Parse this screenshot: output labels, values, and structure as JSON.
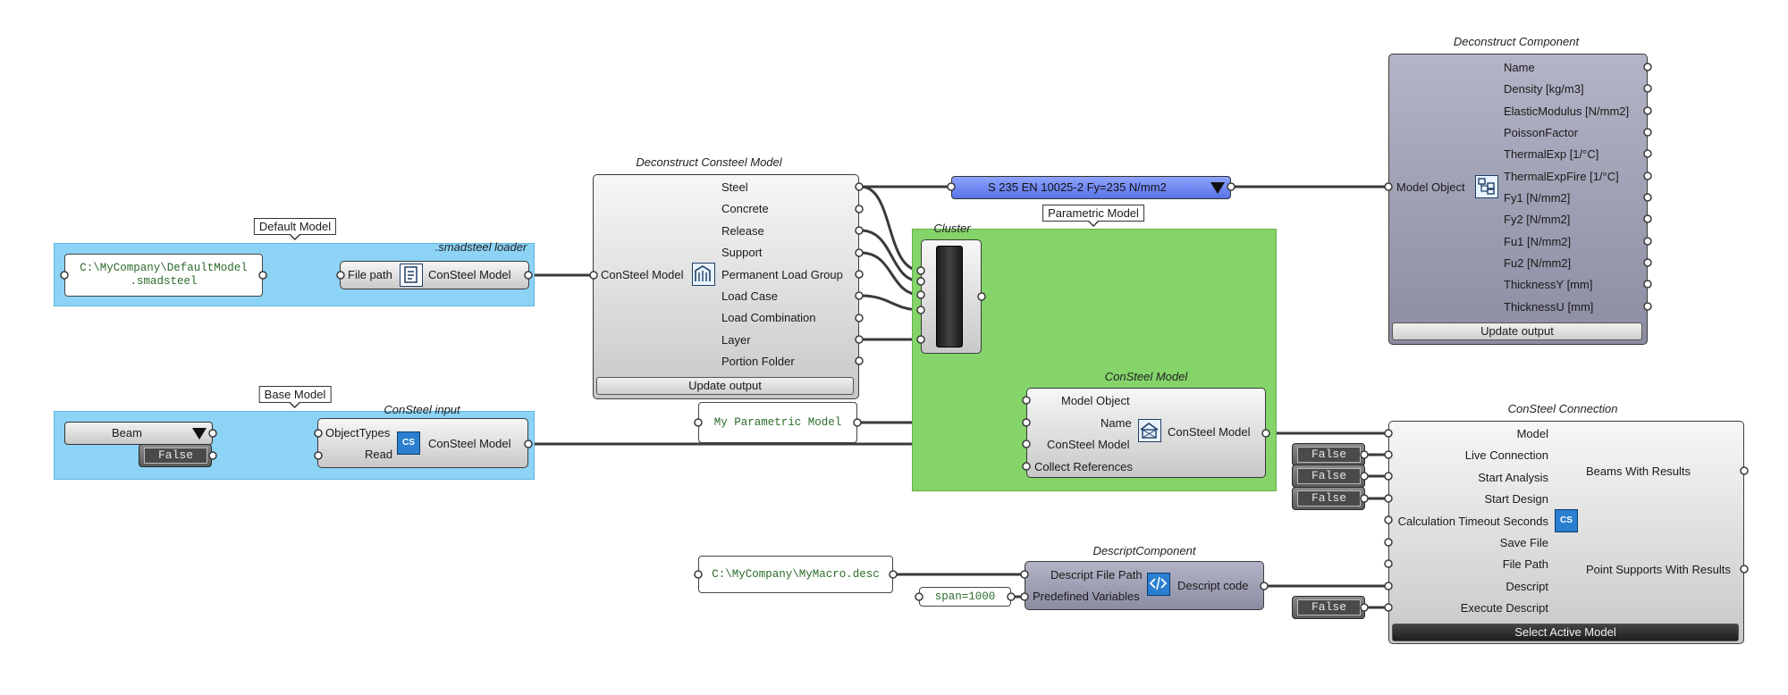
{
  "groups": {
    "default_model": {
      "tag": "Default Model",
      "title": ".smadsteel loader"
    },
    "base_model": {
      "tag": "Base Model",
      "title": "ConSteel input"
    },
    "parametric_model": {
      "tag": "Parametric Model",
      "title": "Cluster"
    }
  },
  "panels": {
    "default_path": "C:\\MyCompany\\DefaultModel\n.smadsteel",
    "parametric_name": "My Parametric Model",
    "macro_path": "C:\\MyCompany\\MyMacro.desc",
    "span": "span=1000"
  },
  "loader": {
    "input": "File path",
    "output": "ConSteel Model"
  },
  "input_comp": {
    "inputs": [
      "ObjectTypes",
      "Read"
    ],
    "output": "ConSteel Model",
    "beam_value": "Beam",
    "read_value": "False"
  },
  "deconstruct_model": {
    "title": "Deconstruct Consteel Model",
    "input": "ConSteel Model",
    "outputs": [
      "Steel",
      "Concrete",
      "Release",
      "Support",
      "Permanent Load Group",
      "Load Case",
      "Load Combination",
      "Layer",
      "Portion Folder"
    ],
    "button": "Update output"
  },
  "material_list": {
    "value": "S 235 EN 10025-2 Fy=235 N/mm2"
  },
  "deconstruct_component": {
    "title": "Deconstruct Component",
    "input": "Model Object",
    "outputs": [
      "Name",
      "Density [kg/m3]",
      "ElasticModulus [N/mm2]",
      "PoissonFactor",
      "ThermalExp [1/°C]",
      "ThermalExpFire [1/°C]",
      "Fy1 [N/mm2]",
      "Fy2 [N/mm2]",
      "Fu1 [N/mm2]",
      "Fu2 [N/mm2]",
      "ThicknessY [mm]",
      "ThicknessU [mm]"
    ],
    "button": "Update output"
  },
  "consteel_model": {
    "title": "ConSteel Model",
    "inputs": [
      "Model Object",
      "Name",
      "ConSteel Model",
      "Collect References"
    ],
    "output": "ConSteel Model"
  },
  "descript": {
    "title": "DescriptComponent",
    "inputs": [
      "Descript File Path",
      "Predefined Variables"
    ],
    "output": "Descript code"
  },
  "connection": {
    "title": "ConSteel Connection",
    "inputs": [
      "Model",
      "Live Connection",
      "Start Analysis",
      "Start Design",
      "Calculation Timeout Seconds",
      "Save File",
      "File Path",
      "Descript",
      "Execute Descript"
    ],
    "outputs": [
      "Beams With Results",
      "Point Supports With Results"
    ],
    "button": "Select Active Model",
    "toggles": [
      "False",
      "False",
      "False",
      "False"
    ]
  },
  "colors": {
    "group_blue": "#8dd3f5",
    "group_green": "#84d46a",
    "value_list": "#6d86f0",
    "wire": "#3a3a3a"
  }
}
